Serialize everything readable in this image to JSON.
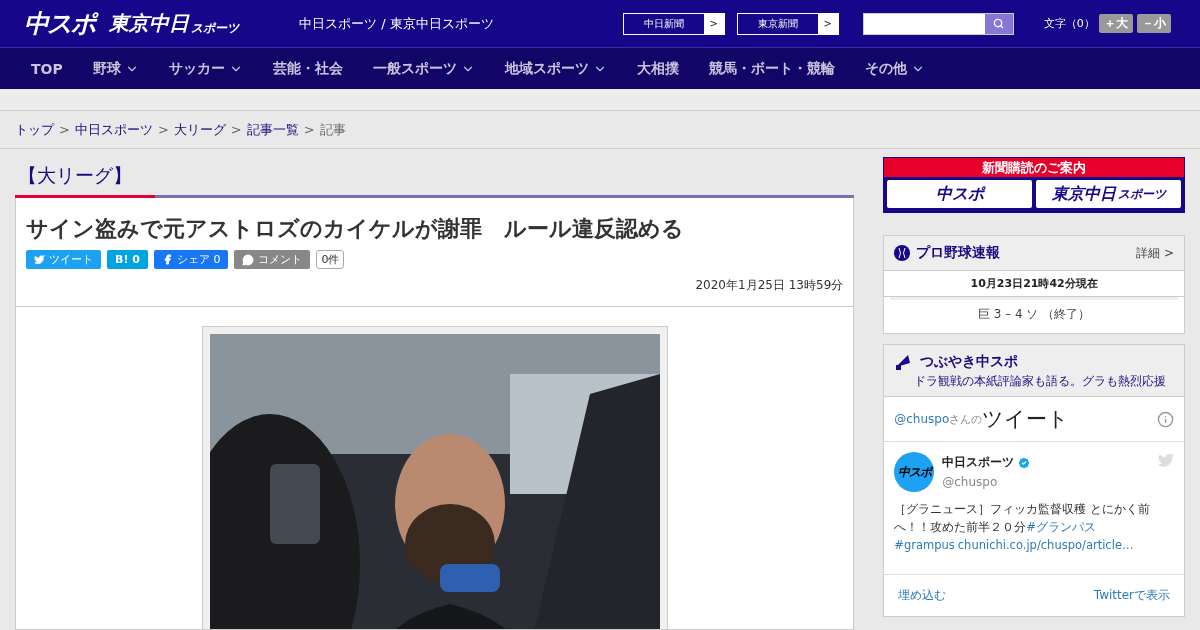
{
  "header": {
    "logo_main": "中スポ",
    "logo_tokyo": "東京中日",
    "logo_tokyo_sub": "スポーツ",
    "site_links": "中日スポーツ / 東京中日スポーツ",
    "paper_links": [
      {
        "label": "中日新聞",
        "arrow": ">"
      },
      {
        "label": "東京新聞",
        "arrow": ">"
      }
    ],
    "font_size": {
      "label": "文字（0）",
      "buttons": [
        "＋大",
        "－小"
      ]
    }
  },
  "nav": [
    {
      "label": "TOP",
      "dropdown": false
    },
    {
      "label": "野球",
      "dropdown": true
    },
    {
      "label": "サッカー",
      "dropdown": true
    },
    {
      "label": "芸能・社会",
      "dropdown": false
    },
    {
      "label": "一般スポーツ",
      "dropdown": true
    },
    {
      "label": "地域スポーツ",
      "dropdown": true
    },
    {
      "label": "大相撲",
      "dropdown": false
    },
    {
      "label": "競馬・ボート・競輪",
      "dropdown": false
    },
    {
      "label": "その他",
      "dropdown": true
    }
  ],
  "breadcrumb": [
    {
      "label": "トップ",
      "link": true
    },
    {
      "label": "中日スポーツ",
      "link": true
    },
    {
      "label": "大リーグ",
      "link": true
    },
    {
      "label": "記事一覧",
      "link": true
    },
    {
      "label": "記事",
      "link": false
    }
  ],
  "breadcrumb_separator": ">",
  "category": "【大リーグ】",
  "article": {
    "title": "サイン盗みで元アストロズのカイケルが謝罪　ルール違反認める",
    "share": [
      {
        "kind": "twitter",
        "label": "ツイート"
      },
      {
        "kind": "hatena",
        "label": "B!",
        "count": "0"
      },
      {
        "kind": "facebook",
        "label": "シェア",
        "count": "0"
      },
      {
        "kind": "comment",
        "label": "コメント",
        "count": "0件"
      }
    ],
    "date": "2020年1月25日 13時59分"
  },
  "sidebar": {
    "subscribe": {
      "title": "新聞購読のご案内",
      "logos": [
        "中スポ",
        "東京中日"
      ],
      "logo_sub": "スポーツ"
    },
    "baseball": {
      "title": "プロ野球速報",
      "detail": "詳細 >",
      "time": "10月23日21時42分現在",
      "score": "巨 3 – 4 ソ （終了）"
    },
    "tweets": {
      "title": "つぶやき中スポ",
      "subtitle": "ドラ観戦の本紙評論家も語る。グラも熱烈応援",
      "handle": "@chuspo",
      "handle_suffix": "さんの",
      "heading": "ツイート",
      "account": "中日スポーツ",
      "avatar_text": "中スポ",
      "account_handle": "@chuspo",
      "body": [
        {
          "text": "［グラニュース］フィッカ監督収穫 とにかく前へ！！攻めた前半２０分",
          "link": false
        },
        {
          "text": "#グランパス",
          "link": true
        },
        {
          "text": "#grampus",
          "link": true
        },
        {
          "text": "chunichi.co.jp/chuspo/article…",
          "link": true
        }
      ],
      "embed": "埋め込む",
      "view": "Twitterで表示"
    }
  }
}
